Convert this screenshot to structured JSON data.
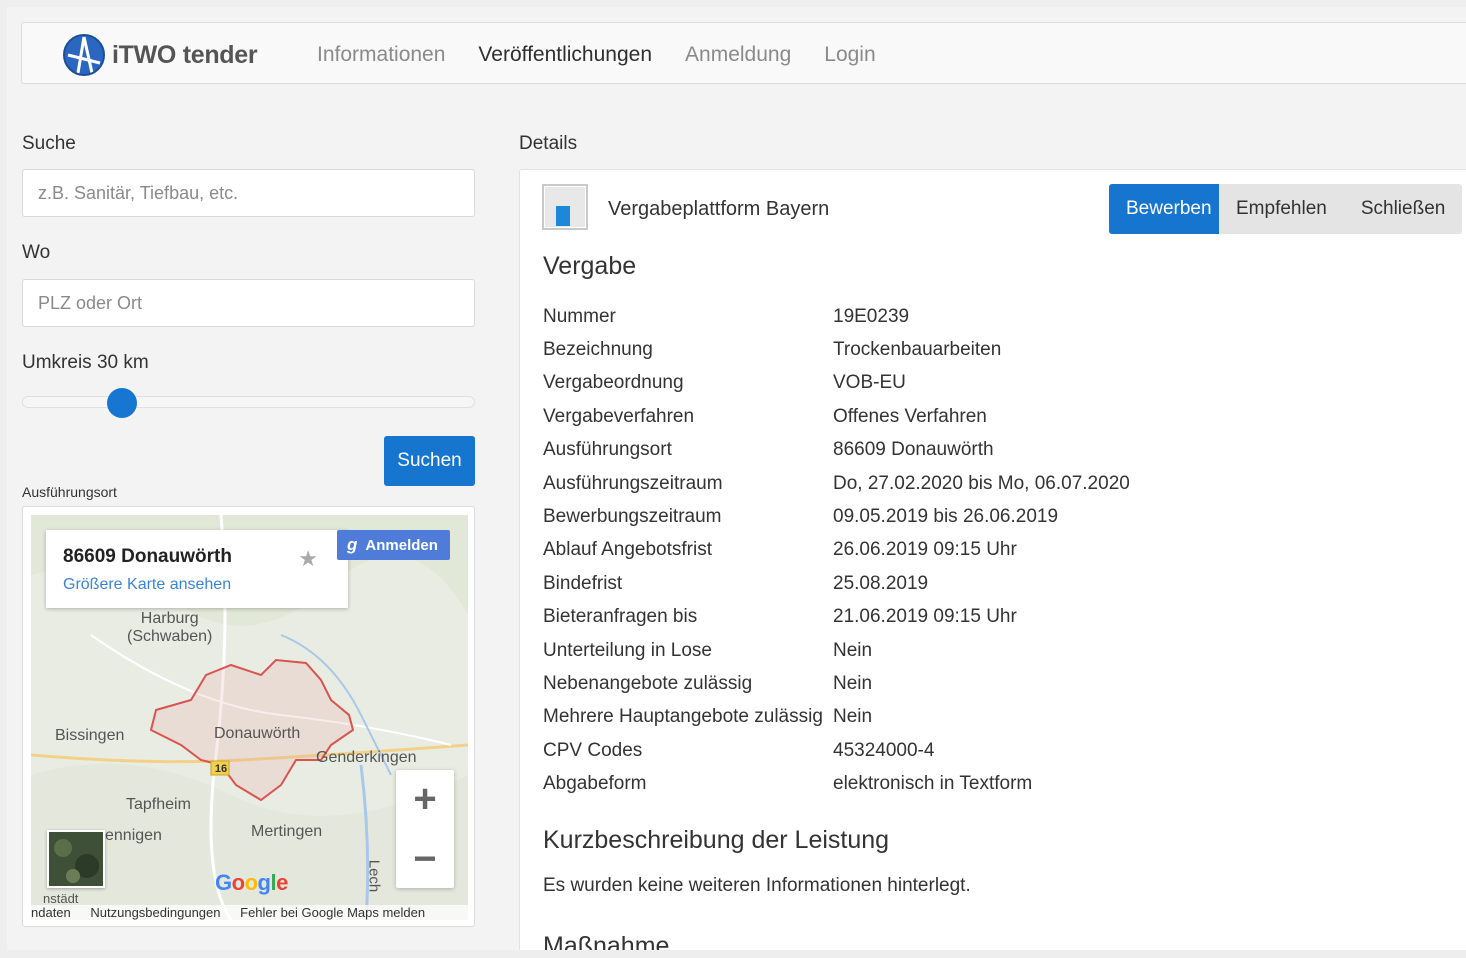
{
  "nav": {
    "brand": "iTWO tender",
    "links": [
      "Informationen",
      "Veröffentlichungen",
      "Anmeldung",
      "Login"
    ],
    "active_index": 1
  },
  "search": {
    "suche_label": "Suche",
    "suche_placeholder": "z.B. Sanitär, Tiefbau, etc.",
    "wo_label": "Wo",
    "wo_placeholder": "PLZ oder Ort",
    "umkreis_label": "Umkreis 30 km",
    "umkreis_fraction": 0.22,
    "submit_label": "Suchen"
  },
  "map": {
    "section_label": "Ausführungsort",
    "card_title": "86609 Donauwörth",
    "card_link": "Größere Karte ansehen",
    "signin_label": "Anmelden",
    "places": [
      "Harburg\n(Schwaben)",
      "Bissingen",
      "Donauwörth",
      "Genderkingen",
      "Tapfheim",
      "Mertingen",
      "ennigen",
      "Lech",
      "nstädt"
    ],
    "road_number": "16",
    "zoom_in": "+",
    "zoom_out": "−",
    "google_logo": "Google",
    "footer_links": [
      "ndaten",
      "Nutzungsbedingungen",
      "Fehler bei Google Maps melden"
    ]
  },
  "details": {
    "section_label": "Details",
    "platform_name": "Vergabeplattform Bayern",
    "buttons": [
      "Bewerben",
      "Empfehlen",
      "Schließen"
    ],
    "vergabe_title": "Vergabe",
    "fields": [
      {
        "key": "Nummer",
        "value": "19E0239"
      },
      {
        "key": "Bezeichnung",
        "value": "Trockenbauarbeiten"
      },
      {
        "key": "Vergabeordnung",
        "value": "VOB-EU"
      },
      {
        "key": "Vergabeverfahren",
        "value": "Offenes Verfahren"
      },
      {
        "key": "Ausführungsort",
        "value": "86609 Donauwörth"
      },
      {
        "key": "Ausführungszeitraum",
        "value": "Do, 27.02.2020 bis Mo, 06.07.2020"
      },
      {
        "key": "Bewerbungszeitraum",
        "value": "09.05.2019 bis 26.06.2019"
      },
      {
        "key": "Ablauf Angebotsfrist",
        "value": "26.06.2019 09:15 Uhr"
      },
      {
        "key": "Bindefrist",
        "value": "25.08.2019"
      },
      {
        "key": "Bieteranfragen bis",
        "value": "21.06.2019 09:15 Uhr"
      },
      {
        "key": "Unterteilung in Lose",
        "value": "Nein"
      },
      {
        "key": "Nebenangebote zulässig",
        "value": "Nein"
      },
      {
        "key": "Mehrere Hauptangebote zulässig",
        "value": "Nein"
      },
      {
        "key": "CPV Codes",
        "value": "45324000-4"
      },
      {
        "key": "Abgabeform",
        "value": "elektronisch in Textform"
      }
    ],
    "kurz_title": "Kurzbeschreibung der Leistung",
    "kurz_text": "Es wurden keine weiteren Informationen hinterlegt.",
    "massnahme_title": "Maßnahme"
  },
  "colors": {
    "primary": "#1675cf",
    "link": "#3a84d8",
    "map_boundary": "#d9534f"
  }
}
